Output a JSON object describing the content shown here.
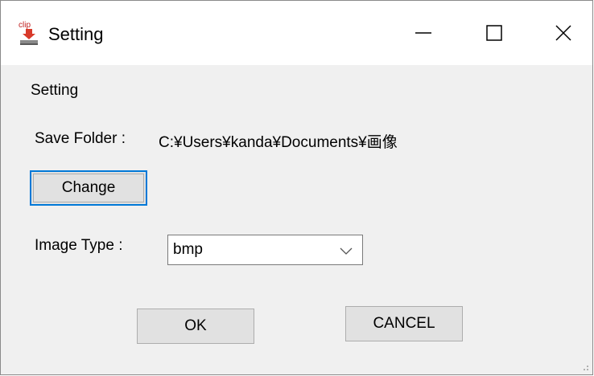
{
  "window": {
    "title": "Setting",
    "app_icon_text": "clip",
    "controls": {
      "minimize_icon": "minimize-icon",
      "maximize_icon": "maximize-icon",
      "close_icon": "close-icon"
    }
  },
  "form": {
    "heading": "Setting",
    "save_folder_label": "Save Folder :",
    "save_folder_path": "C:¥Users¥kanda¥Documents¥画像",
    "change_button": "Change",
    "image_type_label": "Image Type :",
    "image_type_value": "bmp"
  },
  "actions": {
    "ok": "OK",
    "cancel": "CANCEL"
  },
  "colors": {
    "focus_border": "#0078d7",
    "dialog_background": "#f0f0f0",
    "button_face": "#e1e1e1"
  }
}
